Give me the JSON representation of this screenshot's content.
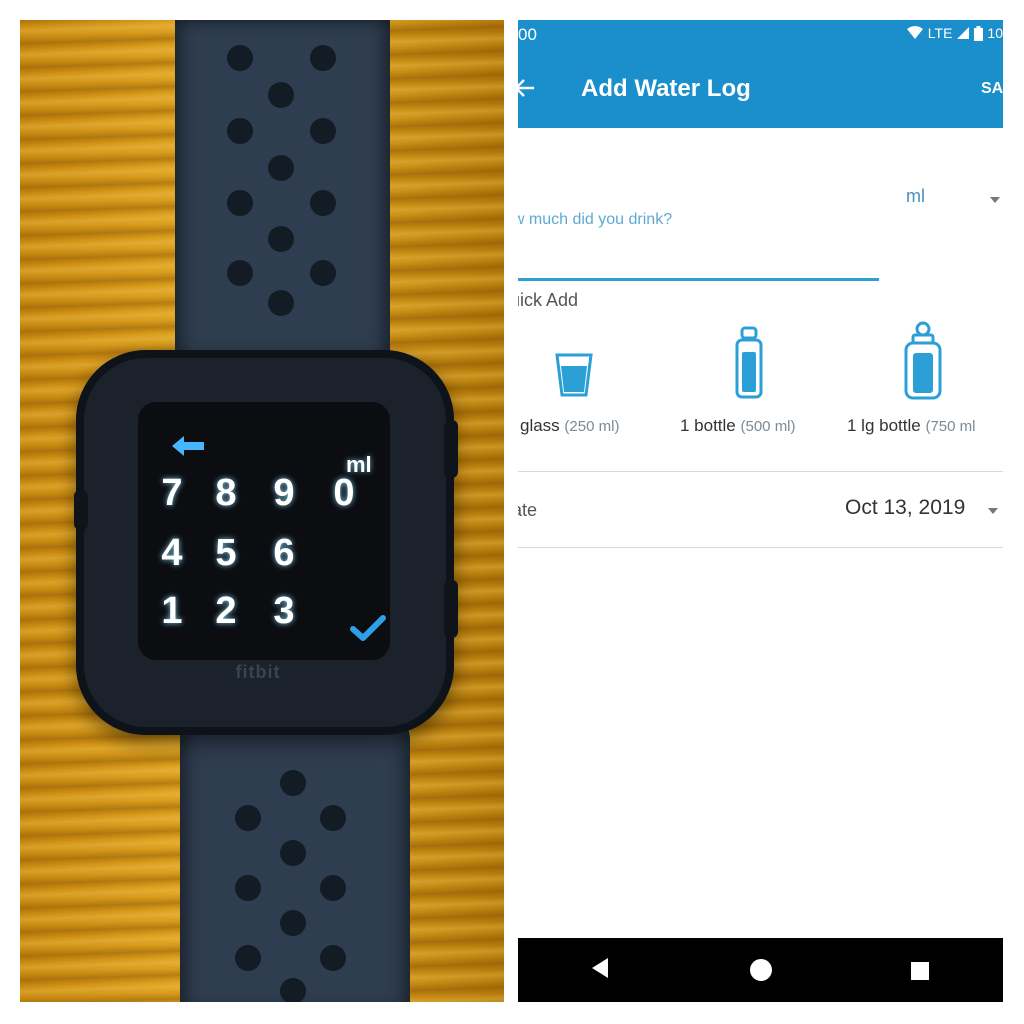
{
  "watch": {
    "brand": "fitbit",
    "unit": "ml",
    "keypad": {
      "row1": [
        "7",
        "8",
        "9",
        "0"
      ],
      "row2": [
        "4",
        "5",
        "6"
      ],
      "row3": [
        "1",
        "2",
        "3"
      ]
    },
    "icons": {
      "back": "back-arrow-icon",
      "confirm": "checkmark-icon"
    }
  },
  "phone": {
    "status_bar": {
      "time": "00",
      "network": "LTE",
      "battery": "10"
    },
    "app_bar": {
      "title": "Add Water Log",
      "save_label": "SA"
    },
    "amount": {
      "placeholder": "ow much did you drink?",
      "unit": "ml"
    },
    "quick_add": {
      "label": "uick Add",
      "items": [
        {
          "label": "glass",
          "amount": "(250 ml)",
          "icon": "glass-icon"
        },
        {
          "label": "1 bottle",
          "amount": "(500 ml)",
          "icon": "bottle-icon"
        },
        {
          "label": "1 lg bottle",
          "amount": "(750 ml",
          "icon": "large-bottle-icon"
        }
      ]
    },
    "date": {
      "label": "ate",
      "value": "Oct 13, 2019"
    },
    "nav": [
      "back",
      "home",
      "recents"
    ]
  },
  "colors": {
    "accent": "#1b8fcb",
    "input_underline": "#2c9fd6",
    "watch_glow": "#46b6ff",
    "table_wood": "#d99a18",
    "strap": "#2e3d4f"
  }
}
